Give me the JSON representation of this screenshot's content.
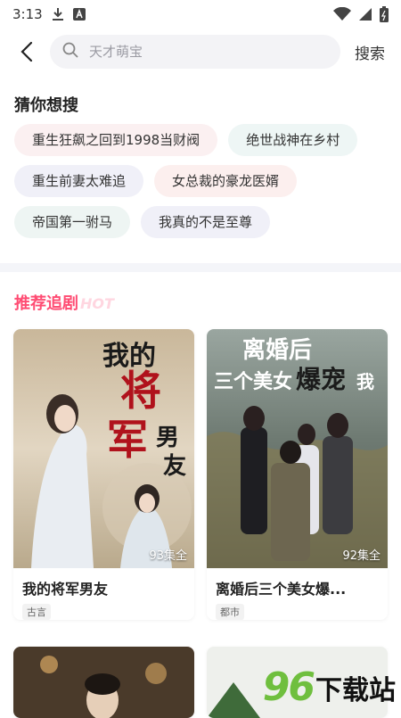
{
  "status_bar": {
    "time": "3:13",
    "icons_left": [
      "download-icon",
      "a-icon"
    ],
    "icons_right": [
      "wifi-icon",
      "signal-icon",
      "battery-icon"
    ]
  },
  "search": {
    "placeholder": "天才萌宝",
    "button_label": "搜索"
  },
  "guess": {
    "title": "猜你想搜",
    "chips": [
      "重生狂飙之回到1998当财阀",
      "绝世战神在乡村",
      "重生前妻太难追",
      "女总裁的豪龙医婿",
      "帝国第一驸马",
      "我真的不是至尊"
    ]
  },
  "recommend": {
    "title": "推荐追剧",
    "hot_label": "HOT",
    "cards": [
      {
        "poster_text": "我的将军男友",
        "episodes": "93集全",
        "title": "我的将军男友",
        "tag": "古言"
      },
      {
        "poster_text": "离婚后三个美女爆宠我",
        "episodes": "92集全",
        "title": "离婚后三个美女爆...",
        "tag": "都市"
      }
    ]
  },
  "watermark": {
    "number": "96",
    "text": "下载站"
  },
  "colors": {
    "accent": "#ff4c73",
    "chip_pink": "#fbf0f1",
    "chip_mint": "#eef6f5",
    "watermark_green": "#6fbf3e"
  }
}
